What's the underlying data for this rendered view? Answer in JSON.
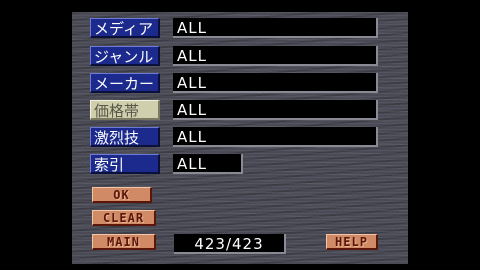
{
  "filters": [
    {
      "label": "メディア",
      "value": "ALL",
      "selected": false
    },
    {
      "label": "ジャンル",
      "value": "ALL",
      "selected": false
    },
    {
      "label": "メーカー",
      "value": "ALL",
      "selected": false
    },
    {
      "label": "価格帯",
      "value": "ALL",
      "selected": true
    },
    {
      "label": "激烈技",
      "value": "ALL",
      "selected": false
    },
    {
      "label": "索引",
      "value": "ALL",
      "selected": false
    }
  ],
  "buttons": {
    "ok": "OK",
    "clear": "CLEAR",
    "main": "MAIN",
    "help": "HELP"
  },
  "counter": "423/423",
  "colors": {
    "label_bg": "#1b2a8c",
    "label_selected_bg": "#cfcfae",
    "button_bg": "#d08a66",
    "panel_bg": "#4a4a56"
  }
}
